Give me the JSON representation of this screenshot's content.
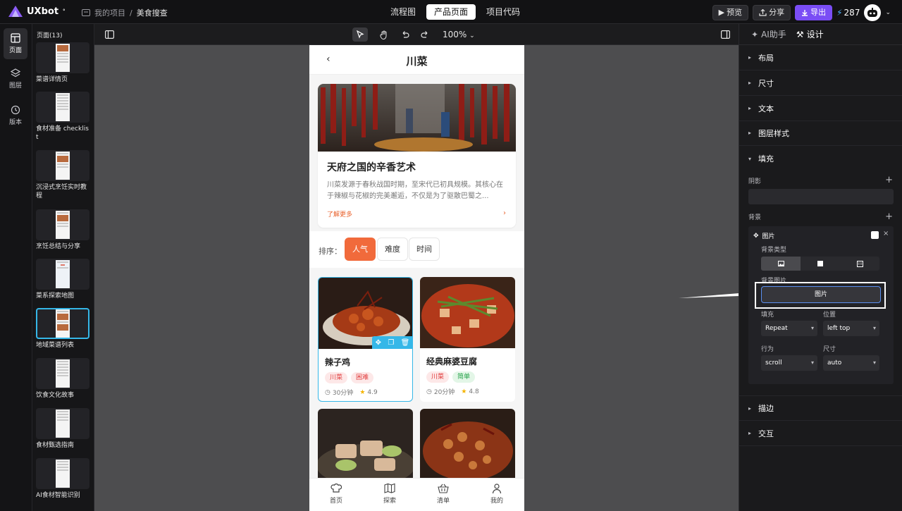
{
  "app": {
    "name": "UXbot"
  },
  "breadcrumb": {
    "project": "我的项目",
    "separator": "/",
    "current": "美食搜查"
  },
  "top_tabs": [
    "流程图",
    "产品页面",
    "项目代码"
  ],
  "top_actions": {
    "preview": "预览",
    "share": "分享",
    "export": "导出",
    "credits": "287"
  },
  "rail": [
    {
      "label": "页面",
      "icon": "pages-icon"
    },
    {
      "label": "图层",
      "icon": "layers-icon"
    },
    {
      "label": "版本",
      "icon": "history-icon"
    }
  ],
  "pages_panel": {
    "title": "页面(13)",
    "items": [
      "菜谱详情页",
      "食材准备 checklist",
      "沉浸式烹饪实时教程",
      "烹饪总结与分享",
      "菜系探索地图",
      "地域菜谱列表",
      "饮食文化故事",
      "食材甄选指南",
      "AI食材智能识别"
    ]
  },
  "canvas": {
    "zoom": "100%"
  },
  "phone": {
    "title": "川菜",
    "hero": {
      "heading": "天府之国的辛香艺术",
      "body": "川菜发源于春秋战国时期，至宋代已初具规模。其核心在于辣椒与花椒的完美邂逅，不仅是为了驱散巴蜀之...",
      "more": "了解更多"
    },
    "sort": {
      "label": "排序：",
      "options": [
        "人气",
        "难度",
        "时间"
      ]
    },
    "cards": [
      {
        "title": "辣子鸡",
        "tags": [
          "川菜",
          "困难"
        ],
        "time": "30分钟",
        "rating": "4.9"
      },
      {
        "title": "经典麻婆豆腐",
        "tags": [
          "川菜",
          "简单"
        ],
        "time": "20分钟",
        "rating": "4.8"
      }
    ],
    "tabbar": [
      "首页",
      "探索",
      "清单",
      "我的"
    ]
  },
  "right_panel": {
    "tabs": [
      "AI助手",
      "设计"
    ],
    "sections": [
      "布局",
      "尺寸",
      "文本",
      "图层样式",
      "填充"
    ],
    "shadow_label": "阴影",
    "background_label": "背景",
    "layer": {
      "name": "图片"
    },
    "bg_type_label": "背景类型",
    "bg_image_label": "背景图片",
    "bg_image_button": "图片",
    "fill_label": "填充",
    "fill_value": "Repeat",
    "position_label": "位置",
    "position_value": "left top",
    "behavior_label": "行为",
    "behavior_value": "scroll",
    "size_label": "尺寸",
    "size_value": "auto",
    "bottom_sections": [
      "描边",
      "交互"
    ]
  },
  "colors": {
    "accent": "#7a4df5",
    "orange": "#f16a3b",
    "selection": "#35b7e8"
  }
}
